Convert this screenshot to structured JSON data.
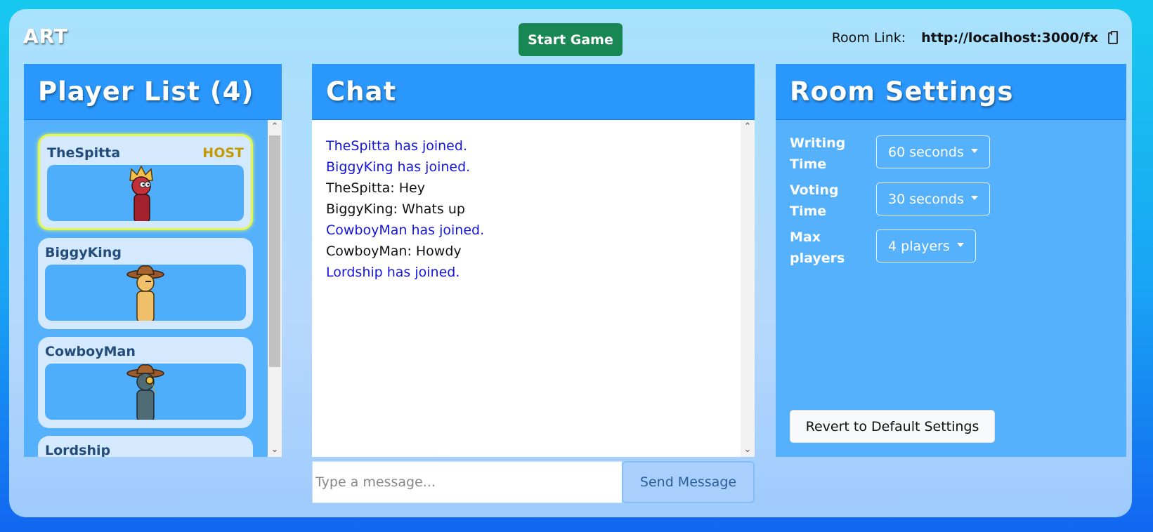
{
  "header": {
    "logo": "ART",
    "start_button": "Start Game",
    "room_link_label": "Room Link:",
    "room_link_url": "http://localhost:3000/fx",
    "copy_icon": "clipboard-icon"
  },
  "players": {
    "title": "Player List (4)",
    "items": [
      {
        "name": "TheSpitta",
        "badge": "HOST",
        "avatar": "red-king-avatar"
      },
      {
        "name": "BiggyKing",
        "badge": "",
        "avatar": "yellow-cowboy-avatar"
      },
      {
        "name": "CowboyMan",
        "badge": "",
        "avatar": "gray-cowboy-monocle-avatar"
      },
      {
        "name": "Lordship",
        "badge": "",
        "avatar": "hidden-avatar"
      }
    ]
  },
  "chat": {
    "title": "Chat",
    "messages": [
      {
        "text": "TheSpitta has joined.",
        "type": "system"
      },
      {
        "text": "BiggyKing has joined.",
        "type": "system"
      },
      {
        "text": "TheSpitta: Hey",
        "type": "user"
      },
      {
        "text": "BiggyKing: Whats up",
        "type": "user"
      },
      {
        "text": "CowboyMan has joined.",
        "type": "system"
      },
      {
        "text": "CowboyMan: Howdy",
        "type": "user"
      },
      {
        "text": "Lordship has joined.",
        "type": "system"
      }
    ],
    "input_placeholder": "Type a message...",
    "send_button": "Send Message"
  },
  "settings": {
    "title": "Room Settings",
    "writing_time_label": "Writing Time",
    "writing_time_value": "60 seconds",
    "voting_time_label": "Voting Time",
    "voting_time_value": "30 seconds",
    "max_players_label": "Max players",
    "max_players_value": "4 players",
    "revert_button": "Revert to Default Settings"
  },
  "colors": {
    "system_message": "#1515e0",
    "host_badge": "#c39a06",
    "start_button": "#198754",
    "panel_header": "#2a97fc"
  }
}
